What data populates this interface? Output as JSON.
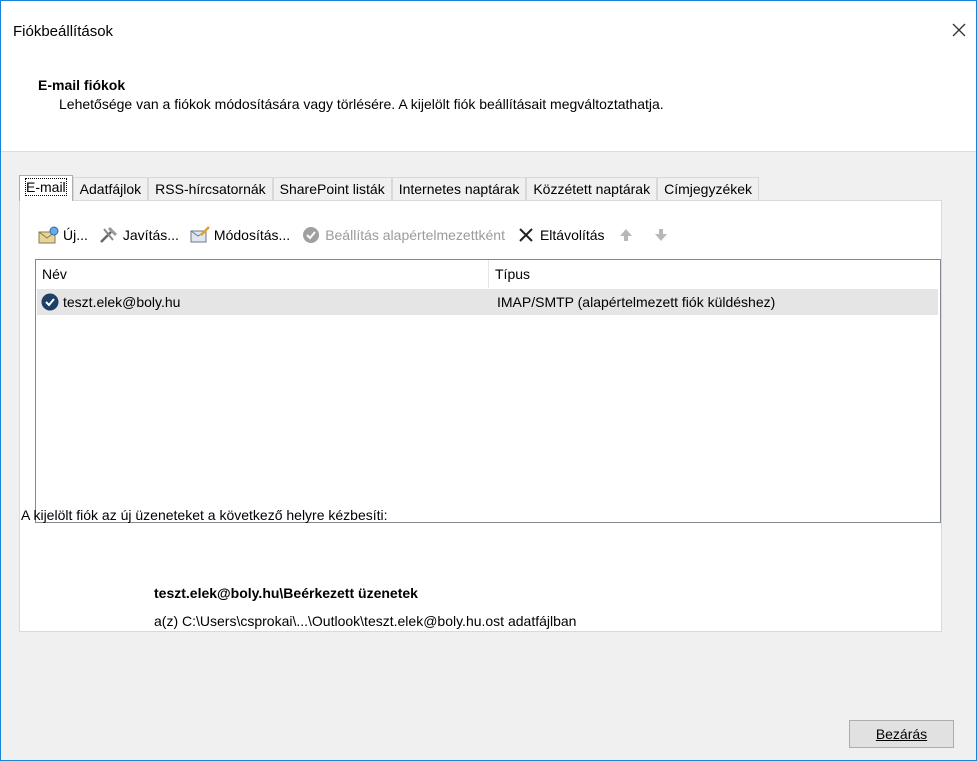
{
  "window": {
    "title": "Fiókbeállítások",
    "close_icon": "close-icon"
  },
  "header": {
    "title": "E-mail fiókok",
    "description": "Lehetősége van a fiókok módosítására vagy törlésére. A kijelölt fiók beállításait megváltoztathatja."
  },
  "tabs": [
    {
      "label": "E-mail",
      "active": true
    },
    {
      "label": "Adatfájlok"
    },
    {
      "label": "RSS-hírcsatornák"
    },
    {
      "label": "SharePoint listák"
    },
    {
      "label": "Internetes naptárak"
    },
    {
      "label": "Közzétett naptárak"
    },
    {
      "label": "Címjegyzékek"
    }
  ],
  "toolbar": {
    "new_label": "Új...",
    "repair_label": "Javítás...",
    "change_label": "Módosítás...",
    "set_default_label": "Beállítás alapértelmezettként",
    "remove_label": "Eltávolítás"
  },
  "table": {
    "columns": [
      "Név",
      "Típus"
    ],
    "rows": [
      {
        "name": "teszt.elek@boly.hu",
        "type": "IMAP/SMTP (alapértelmezett fiók küldéshez)"
      }
    ]
  },
  "delivery": {
    "intro": "A kijelölt fiók az új üzeneteket a következő helyre kézbesíti:",
    "folder": "teszt.elek@boly.hu\\Beérkezett üzenetek",
    "path": "a(z) C:\\Users\\csprokai\\...\\Outlook\\teszt.elek@boly.hu.ost adatfájlban"
  },
  "footer": {
    "close_label": "Bezárás"
  },
  "colors": {
    "accent": "#1883d7",
    "selection": "#e5e5e5",
    "body_bg": "#f0f0f0"
  }
}
